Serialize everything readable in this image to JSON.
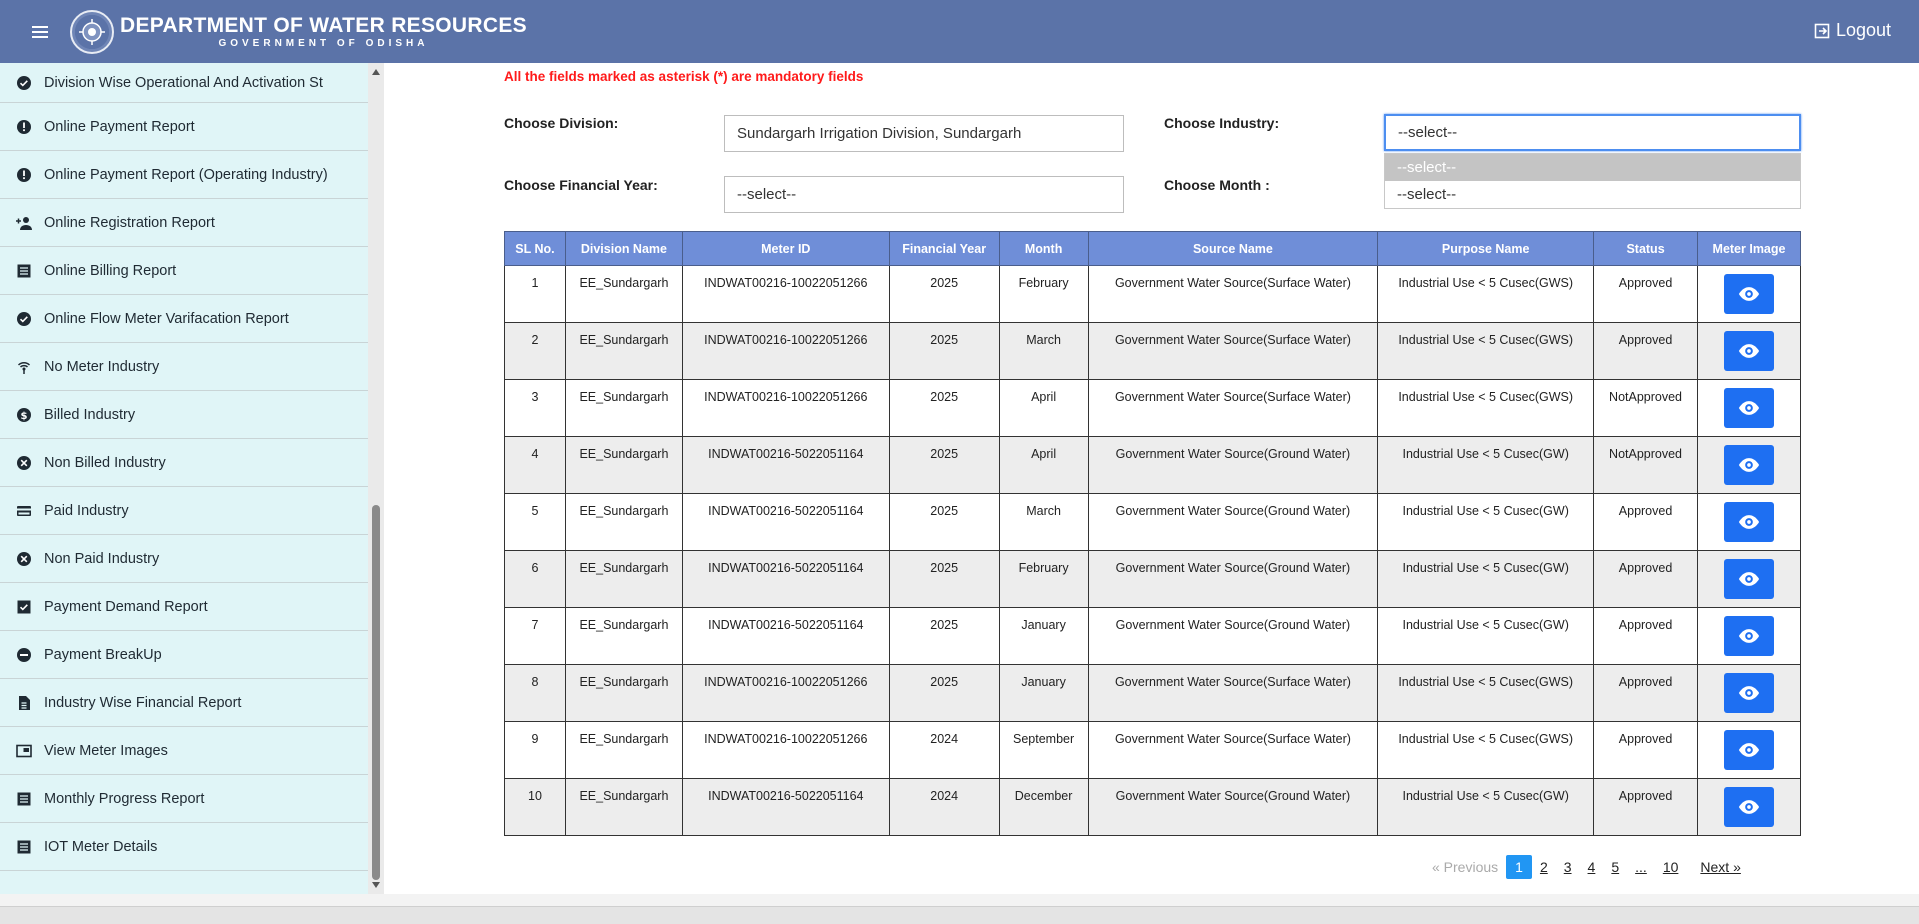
{
  "header": {
    "title": "DEPARTMENT OF WATER RESOURCES",
    "subtitle": "GOVERNMENT OF ODISHA",
    "logout_label": "Logout"
  },
  "sidebar": {
    "items": [
      {
        "label": "Division Wise Operational And Activation St",
        "icon": "check-circle-icon"
      },
      {
        "label": "Online Payment Report",
        "icon": "alert-circle-icon"
      },
      {
        "label": "Online Payment Report (Operating Industry)",
        "icon": "alert-circle-icon"
      },
      {
        "label": "Online Registration Report",
        "icon": "person-add-icon"
      },
      {
        "label": "Online Billing Report",
        "icon": "list-icon"
      },
      {
        "label": "Online Flow Meter Varifacation Report",
        "icon": "check-circle-icon"
      },
      {
        "label": "No Meter Industry",
        "icon": "signal-icon"
      },
      {
        "label": "Billed Industry",
        "icon": "dollar-icon"
      },
      {
        "label": "Non Billed Industry",
        "icon": "cancel-circle-icon"
      },
      {
        "label": "Paid Industry",
        "icon": "credit-card-icon"
      },
      {
        "label": "Non Paid Industry",
        "icon": "cancel-circle-icon"
      },
      {
        "label": "Payment Demand Report",
        "icon": "checkbox-icon"
      },
      {
        "label": "Payment BreakUp",
        "icon": "minus-circle-icon"
      },
      {
        "label": "Industry Wise Financial Report",
        "icon": "document-icon"
      },
      {
        "label": "View Meter Images",
        "icon": "picture-in-picture-icon"
      },
      {
        "label": "Monthly Progress Report",
        "icon": "list-icon"
      },
      {
        "label": "IOT Meter Details",
        "icon": "list-icon"
      }
    ]
  },
  "form": {
    "mandatory_note": "All the fields marked as asterisk (*) are mandatory fields",
    "division_label": "Choose Division:",
    "division_value": "Sundargarh Irrigation Division, Sundargarh",
    "industry_label": "Choose Industry:",
    "industry_value": "--select--",
    "industry_options": [
      "--select--",
      "--select--"
    ],
    "fy_label": "Choose Financial Year:",
    "fy_value": "--select--",
    "month_label": "Choose Month :"
  },
  "table": {
    "headers": [
      "SL No.",
      "Division Name",
      "Meter ID",
      "Financial Year",
      "Month",
      "Source Name",
      "Purpose Name",
      "Status",
      "Meter Image"
    ],
    "rows": [
      [
        "1",
        "EE_Sundargarh",
        "INDWAT00216-10022051266",
        "2025",
        "February",
        "Government Water Source(Surface Water)",
        "Industrial Use < 5 Cusec(GWS)",
        "Approved"
      ],
      [
        "2",
        "EE_Sundargarh",
        "INDWAT00216-10022051266",
        "2025",
        "March",
        "Government Water Source(Surface Water)",
        "Industrial Use < 5 Cusec(GWS)",
        "Approved"
      ],
      [
        "3",
        "EE_Sundargarh",
        "INDWAT00216-10022051266",
        "2025",
        "April",
        "Government Water Source(Surface Water)",
        "Industrial Use < 5 Cusec(GWS)",
        "NotApproved"
      ],
      [
        "4",
        "EE_Sundargarh",
        "INDWAT00216-5022051164",
        "2025",
        "April",
        "Government Water Source(Ground Water)",
        "Industrial Use < 5 Cusec(GW)",
        "NotApproved"
      ],
      [
        "5",
        "EE_Sundargarh",
        "INDWAT00216-5022051164",
        "2025",
        "March",
        "Government Water Source(Ground Water)",
        "Industrial Use < 5 Cusec(GW)",
        "Approved"
      ],
      [
        "6",
        "EE_Sundargarh",
        "INDWAT00216-5022051164",
        "2025",
        "February",
        "Government Water Source(Ground Water)",
        "Industrial Use < 5 Cusec(GW)",
        "Approved"
      ],
      [
        "7",
        "EE_Sundargarh",
        "INDWAT00216-5022051164",
        "2025",
        "January",
        "Government Water Source(Ground Water)",
        "Industrial Use < 5 Cusec(GW)",
        "Approved"
      ],
      [
        "8",
        "EE_Sundargarh",
        "INDWAT00216-10022051266",
        "2025",
        "January",
        "Government Water Source(Surface Water)",
        "Industrial Use < 5 Cusec(GWS)",
        "Approved"
      ],
      [
        "9",
        "EE_Sundargarh",
        "INDWAT00216-10022051266",
        "2024",
        "September",
        "Government Water Source(Surface Water)",
        "Industrial Use < 5 Cusec(GWS)",
        "Approved"
      ],
      [
        "10",
        "EE_Sundargarh",
        "INDWAT00216-5022051164",
        "2024",
        "December",
        "Government Water Source(Ground Water)",
        "Industrial Use < 5 Cusec(GW)",
        "Approved"
      ]
    ]
  },
  "pagination": {
    "previous": "« Previous",
    "pages": [
      "1",
      "2",
      "3",
      "4",
      "5",
      "...",
      "10"
    ],
    "current": "1",
    "next": "Next »"
  },
  "colors": {
    "header_bg": "#5b73a8",
    "sidebar_bg": "#e0f5f7",
    "table_header_bg": "#6f8ed8",
    "eye_button": "#1e6ff2",
    "mandatory_text": "#ff1a1a",
    "active_page": "#2196f3"
  }
}
